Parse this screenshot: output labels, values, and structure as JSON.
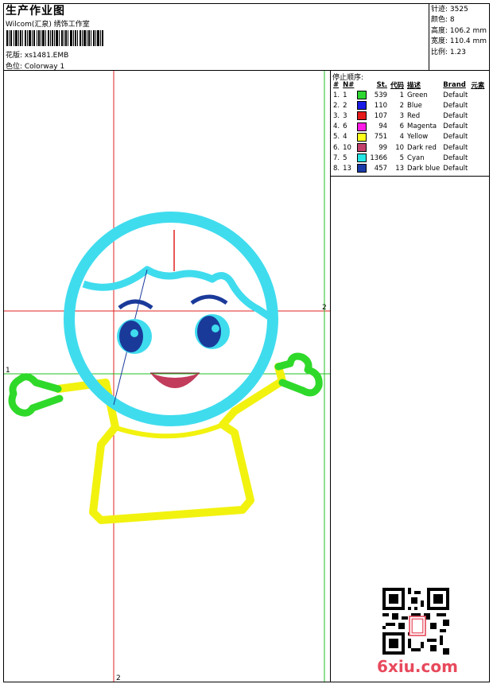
{
  "header": {
    "title": "生产作业图",
    "subtitle": "Wilcom(汇泉) 绣饰工作室",
    "design_label": "花版: xs1481.EMB",
    "colorway_label": "色位:  Colorway 1"
  },
  "stats": {
    "stitches": "针迹: 3525",
    "colors": "颜色: 8",
    "height": "高度: 106.2 mm",
    "width": "宽度: 110.4 mm",
    "scale": "比例: 1.23"
  },
  "stop_sequence": {
    "title": "停止顺序:",
    "headers": [
      "#",
      "N#",
      "",
      "St.",
      "代码",
      "描述",
      "Brand",
      "元素"
    ],
    "rows": [
      {
        "idx": "1.",
        "n": "1",
        "color": "#2dd631",
        "st": "539",
        "code": "1",
        "desc": "Green",
        "brand": "Default"
      },
      {
        "idx": "2.",
        "n": "2",
        "color": "#1a1ae6",
        "st": "110",
        "code": "2",
        "desc": "Blue",
        "brand": "Default"
      },
      {
        "idx": "3.",
        "n": "3",
        "color": "#e61a1a",
        "st": "107",
        "code": "3",
        "desc": "Red",
        "brand": "Default"
      },
      {
        "idx": "4.",
        "n": "6",
        "color": "#ff1ae6",
        "st": "94",
        "code": "6",
        "desc": "Magenta",
        "brand": "Default"
      },
      {
        "idx": "5.",
        "n": "4",
        "color": "#ffff1a",
        "st": "751",
        "code": "4",
        "desc": "Yellow",
        "brand": "Default"
      },
      {
        "idx": "6.",
        "n": "10",
        "color": "#c2406a",
        "st": "99",
        "code": "10",
        "desc": "Dark red",
        "brand": "Default"
      },
      {
        "idx": "7.",
        "n": "5",
        "color": "#26e6e6",
        "st": "1366",
        "code": "5",
        "desc": "Cyan",
        "brand": "Default"
      },
      {
        "idx": "8.",
        "n": "13",
        "color": "#1a3aa8",
        "st": "457",
        "code": "13",
        "desc": "Dark blue",
        "brand": "Default"
      }
    ]
  },
  "guides": {
    "label_2": "2",
    "label_1": "1"
  },
  "colors": {
    "cyan": "#3fdcee",
    "yellow": "#f2f20f",
    "green": "#2fd92a",
    "darkblue": "#1a3a9a",
    "darkred": "#c23c5c",
    "guide_red": "#e02020",
    "guide_green": "#20c020"
  },
  "watermark": {
    "logo_text": "6xiu.com"
  }
}
